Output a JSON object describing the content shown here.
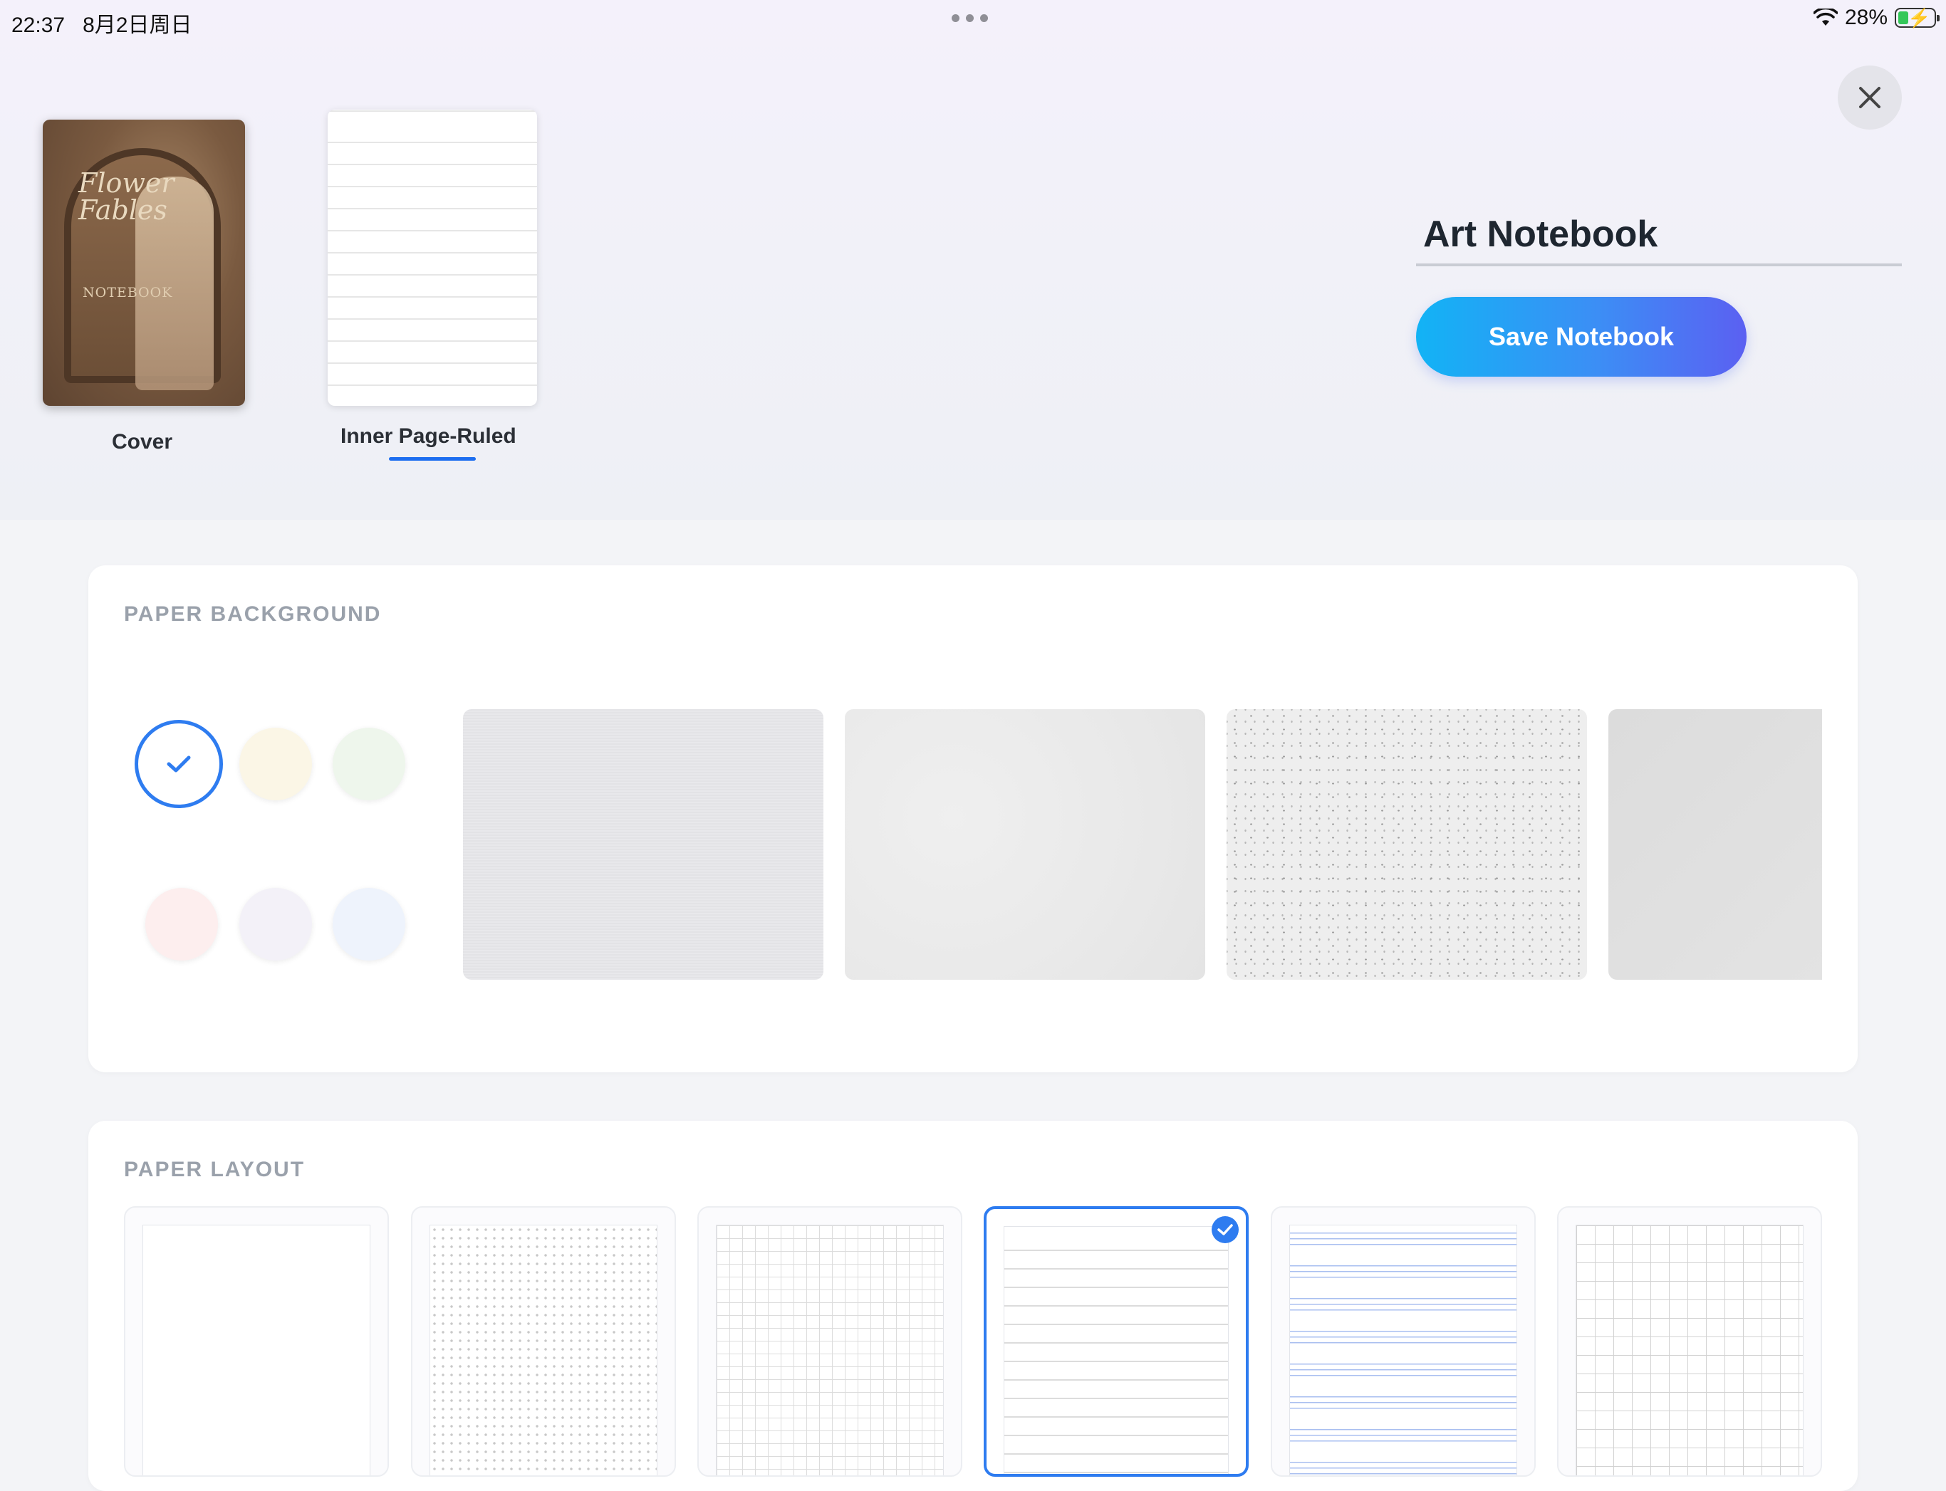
{
  "status_bar": {
    "time": "22:37",
    "date": "8月2日周日",
    "battery": "28%"
  },
  "notebook": {
    "name": "Art Notebook",
    "save_label": "Save Notebook"
  },
  "pages": {
    "cover_label": "Cover",
    "cover_title": "Flower Fables",
    "cover_subtitle": "NOTEBOOK",
    "inner_label": "Inner Page-Ruled"
  },
  "paper_background": {
    "title": "PAPER BACKGROUND",
    "colors": [
      "#ffffff",
      "#fbf6e6",
      "#eef6ec",
      "#fdeeee",
      "#f3f1f8",
      "#eef3fc"
    ],
    "selected_color_index": 0,
    "textures": [
      "linen",
      "smooth",
      "speckled",
      "kraft-grey"
    ]
  },
  "paper_layout": {
    "title": "PAPER LAYOUT",
    "options": [
      "blank",
      "dot-grid",
      "small-grid",
      "ruled",
      "music-staff",
      "large-grid"
    ],
    "selected_index": 3
  },
  "colors": {
    "accent": "#2e7cf0",
    "save_gradient_start": "#12b3f5",
    "save_gradient_end": "#5b60f2"
  }
}
